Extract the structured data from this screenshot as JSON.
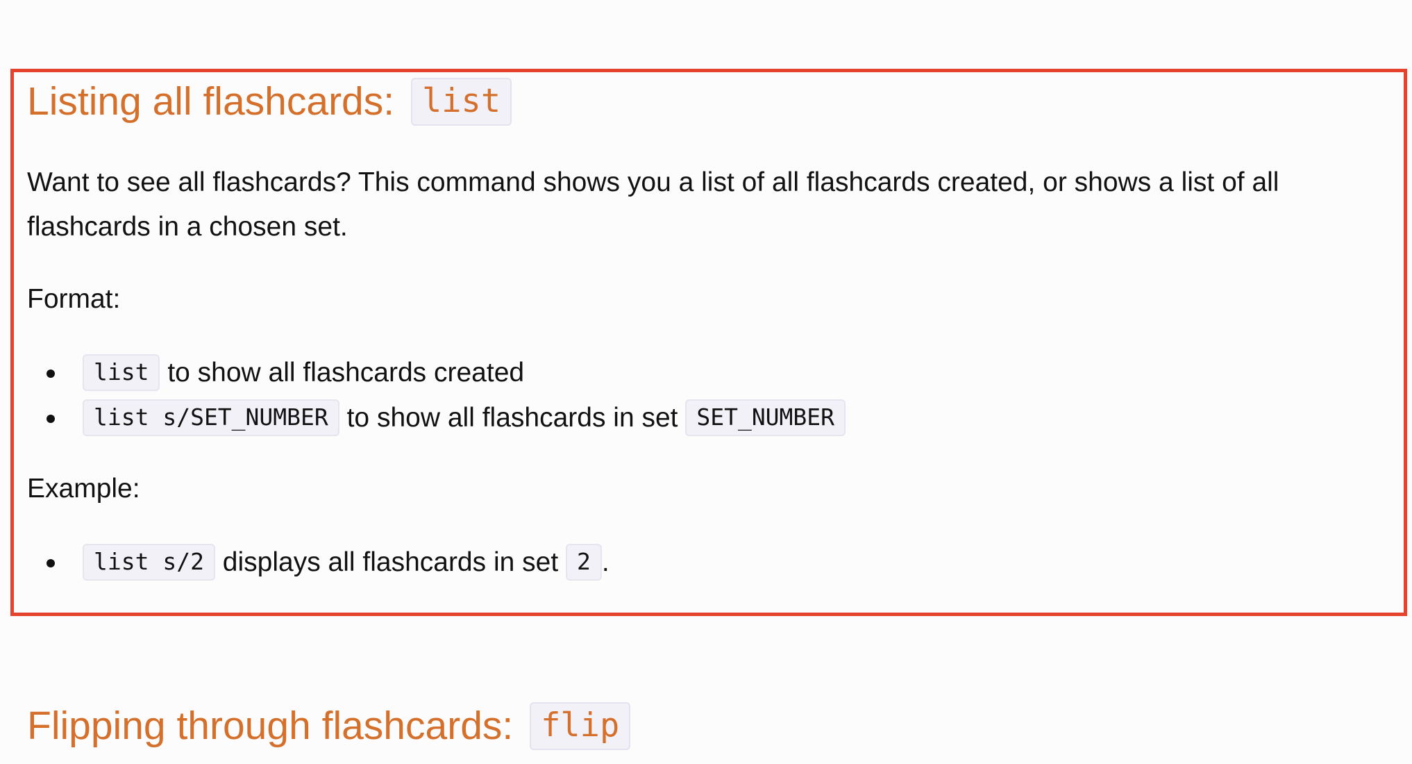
{
  "sections": {
    "list": {
      "heading_text": "Listing all flashcards: ",
      "heading_code": "list",
      "description": "Want to see all flashcards? This command shows you a list of all flashcards created, or shows a list of all flashcards in a chosen set.",
      "format_label": "Format:",
      "format_items": [
        {
          "code": "list",
          "text": " to show all flashcards created",
          "code2": "",
          "suffix": ""
        },
        {
          "code": "list s/SET_NUMBER",
          "text": " to show all flashcards in set ",
          "code2": "SET_NUMBER",
          "suffix": ""
        }
      ],
      "example_label": "Example:",
      "example_items": [
        {
          "code": "list s/2",
          "text": " displays all flashcards in set ",
          "code2": "2",
          "suffix": "."
        }
      ]
    },
    "flip": {
      "heading_text": "Flipping through flashcards: ",
      "heading_code": "flip"
    }
  },
  "colors": {
    "heading": "#d4702c",
    "highlight_border": "#e5432d",
    "code_background": "#f2f1f8"
  }
}
